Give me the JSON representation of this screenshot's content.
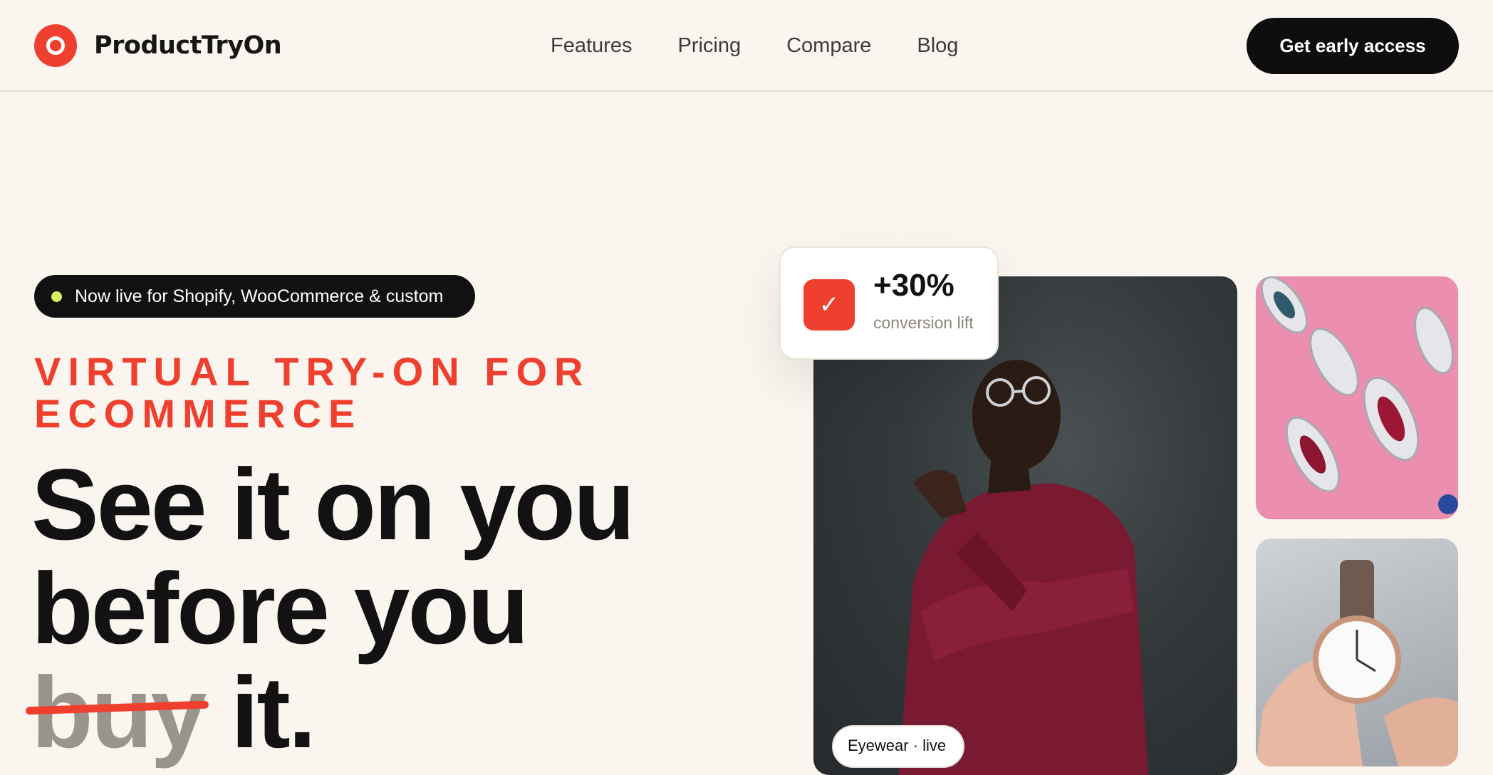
{
  "nav": {
    "brand": "ProductTryOn",
    "links": [
      "Features",
      "Pricing",
      "Compare",
      "Blog"
    ],
    "cta": "Get early access"
  },
  "hero": {
    "badge": "Now live for Shopify, WooCommerce & custom",
    "eyebrow": "VIRTUAL TRY-ON FOR ECOMMERCE",
    "headline": {
      "line1_prefix": "See it on ",
      "line1_highlight": "you",
      "line2": "before you",
      "line3_struck": "buy",
      "line3_suffix": " it."
    }
  },
  "stat": {
    "value": "+30%",
    "label": "conversion lift"
  },
  "images": {
    "main_tag": "Eyewear · live"
  },
  "colors": {
    "accent": "#ee3f2f",
    "highlight": "#d7f25a",
    "background": "#faf6ef",
    "dark": "#0e0e0e"
  },
  "icons": [
    "logo-ring-icon",
    "check-icon",
    "status-dot-icon"
  ]
}
